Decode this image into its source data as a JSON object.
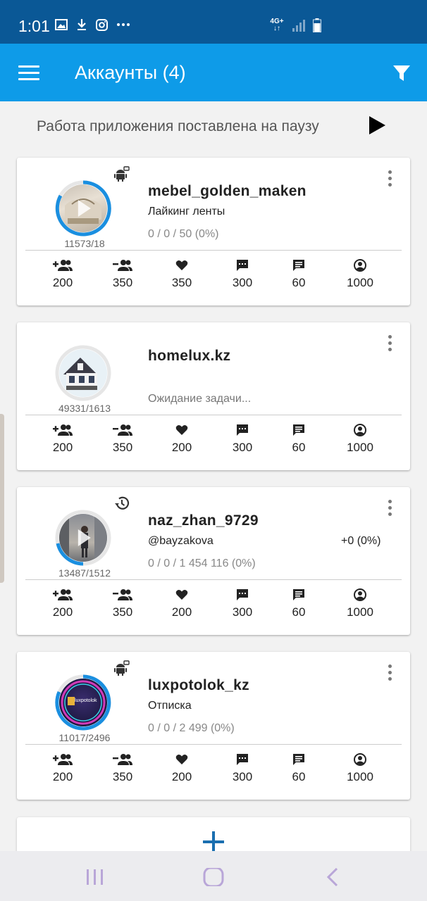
{
  "status_bar": {
    "time": "1:01",
    "network_label_top": "4G+",
    "network_label_bottom": "↓↑",
    "icons": [
      "image-icon",
      "download-icon",
      "instagram-icon",
      "more-dots-icon",
      "signal-icon",
      "battery-icon"
    ]
  },
  "app_bar": {
    "title": "Аккаунты (4)",
    "menu_icon": "hamburger-icon",
    "filter_icon": "filter-icon",
    "color": "#0e9be8"
  },
  "pause_bar": {
    "message": "Работа приложения поставлена на паузу",
    "play_icon": "play-icon"
  },
  "accounts": [
    {
      "username": "mebel_golden_maken",
      "task": "Лайкинг ленты",
      "progress": "0 / 0 / 50 (0%)",
      "stats": "11573/18",
      "status_icon": "android-icon",
      "limits": [
        "200",
        "350",
        "350",
        "300",
        "60",
        "1000"
      ]
    },
    {
      "username": "homelux.kz",
      "task": "Ожидание задачи...",
      "stats": "49331/1613",
      "limits": [
        "200",
        "350",
        "200",
        "300",
        "60",
        "1000"
      ]
    },
    {
      "username": "naz_zhan_9729",
      "task": "@bayzakova",
      "delta": "+0 (0%)",
      "progress": "0 / 0 / 1 454 116 (0%)",
      "stats": "13487/1512",
      "status_icon": "history-icon",
      "limits": [
        "200",
        "350",
        "200",
        "300",
        "60",
        "1000"
      ]
    },
    {
      "username": "luxpotolok_kz",
      "task": "Отписка",
      "progress": "0 / 0 / 2 499 (0%)",
      "stats": "11017/2496",
      "status_icon": "android-icon",
      "limits": [
        "200",
        "350",
        "200",
        "300",
        "60",
        "1000"
      ]
    }
  ],
  "limit_icons": [
    "follow-icon",
    "unfollow-icon",
    "heart-icon",
    "comment-icon",
    "message-icon",
    "profile-icon"
  ],
  "avatar_labels": {
    "luxpotolok": "luxpotolok"
  },
  "add_button_icon": "plus-icon",
  "nav_bar": {
    "icons": [
      "recent-apps-icon",
      "home-icon",
      "back-icon"
    ]
  },
  "colors": {
    "accent": "#0e9be8",
    "status_bar": "#0a5896",
    "ring": "#1a8fe0",
    "add": "#1a6fb0"
  }
}
